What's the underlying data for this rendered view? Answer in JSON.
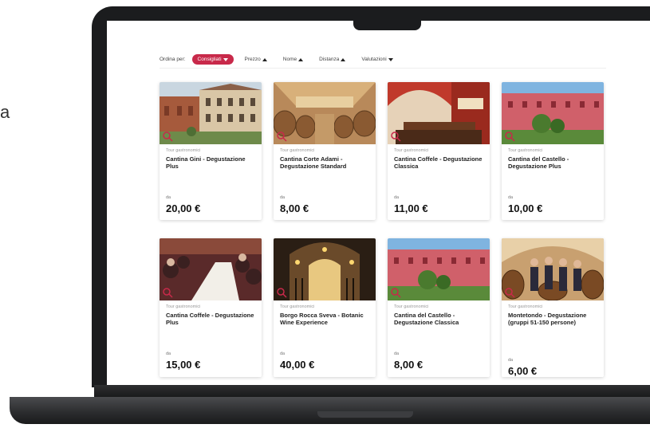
{
  "edge_text": "a",
  "sort": {
    "label": "Ordina per:",
    "active": "Consigliati",
    "options": [
      "Prezzo",
      "Nome",
      "Distanza",
      "Valutazioni"
    ]
  },
  "cards": [
    {
      "category": "Tour gastronomici",
      "title": "Cantina Gini - Degustazione Plus",
      "from": "da",
      "price": "20,00 €",
      "image": "villa-courtyard"
    },
    {
      "category": "Tour gastronomici",
      "title": "Cantina Corte Adami - Degustazione Standard",
      "from": "da",
      "price": "8,00 €",
      "image": "barrel-cellar"
    },
    {
      "category": "Tour gastronomici",
      "title": "Cantina Coffele - Degustazione Classica",
      "from": "da",
      "price": "11,00 €",
      "image": "tasting-room"
    },
    {
      "category": "Tour gastronomici",
      "title": "Cantina del Castello - Degustazione Plus",
      "from": "da",
      "price": "10,00 €",
      "image": "red-castle"
    },
    {
      "category": "Tour gastronomici",
      "title": "Cantina Coffele - Degustazione Plus",
      "from": "da",
      "price": "15,00 €",
      "image": "dinner-guests"
    },
    {
      "category": "Tour gastronomici",
      "title": "Borgo Rocca Sveva - Botanic Wine Experience",
      "from": "da",
      "price": "40,00 €",
      "image": "candle-cellar"
    },
    {
      "category": "Tour gastronomici",
      "title": "Cantina del Castello - Degustazione Classica",
      "from": "da",
      "price": "8,00 €",
      "image": "red-castle"
    },
    {
      "category": "Tour gastronomici",
      "title": "Montetondo - Degustazione (gruppi 51-150 persone)",
      "from": "da",
      "price": "6,00 €",
      "image": "winemakers"
    }
  ],
  "colors": {
    "accent": "#c8294a",
    "bezel": "#1b1c1e"
  }
}
